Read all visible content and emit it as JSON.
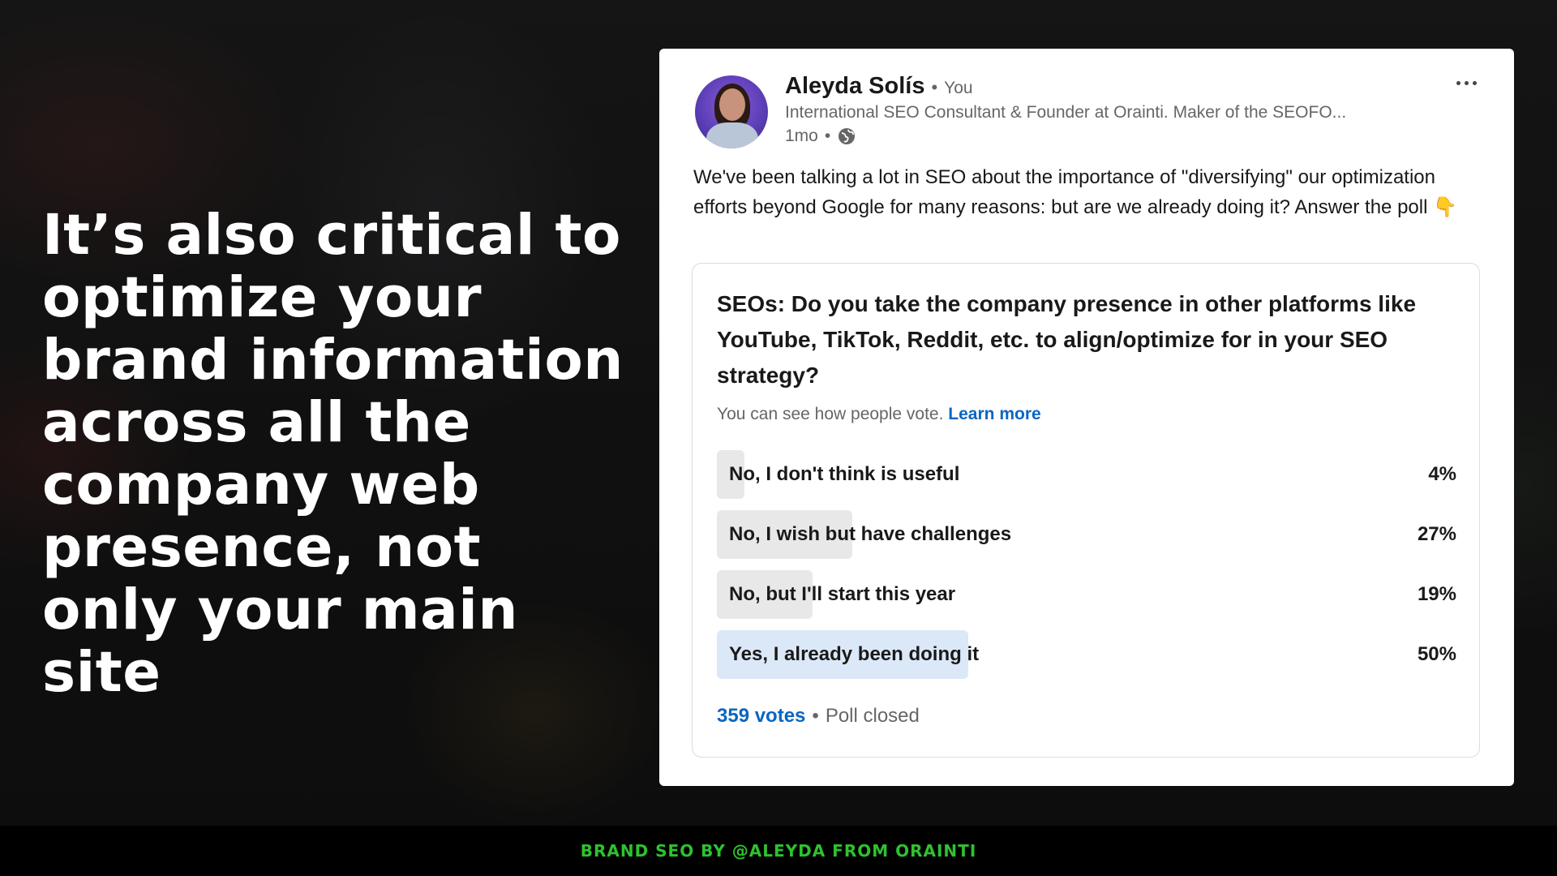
{
  "slide": {
    "headline": "It’s also critical to optimize your brand information across all the company web presence, not only your main site",
    "footer": "BRAND SEO BY @ALEYDA FROM ORAINTI",
    "footer_color": "#2fc12f"
  },
  "post": {
    "author_name": "Aleyda Solís",
    "author_badge": "You",
    "author_headline": "International SEO Consultant & Founder at Orainti. Maker of the SEOFO...",
    "time": "1mo",
    "visibility_icon": "globe-icon",
    "more_icon": "more-icon",
    "text": "We've been talking a lot in SEO about the importance of \"diversifying\" our optimization efforts beyond Google for many reasons: but are we already doing it? Answer the poll 👇"
  },
  "poll": {
    "question": "SEOs: Do you take the company presence in other platforms like YouTube, TikTok, Reddit, etc. to align/optimize for in your SEO strategy?",
    "visibility_note": "You can see how people vote.",
    "learn_more": "Learn more",
    "options": [
      {
        "label": "No, I don't think is useful",
        "percent": "4%",
        "fraction": 0.04,
        "selected": false
      },
      {
        "label": "No, I wish but have challenges",
        "percent": "27%",
        "fraction": 0.27,
        "selected": false
      },
      {
        "label": "No, but I'll start this year",
        "percent": "19%",
        "fraction": 0.19,
        "selected": false
      },
      {
        "label": "Yes, I already been doing it",
        "percent": "50%",
        "fraction": 0.5,
        "selected": true
      }
    ],
    "votes": "359 votes",
    "status": "Poll closed",
    "accent_color": "#0a66c2"
  }
}
